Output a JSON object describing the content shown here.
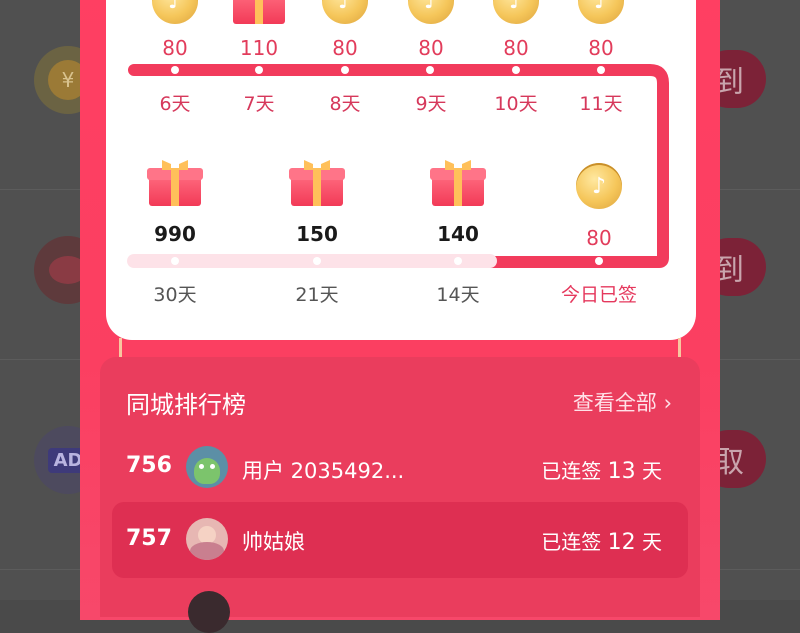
{
  "background": {
    "right_buttons": [
      "到",
      "到",
      "取"
    ],
    "left_icons": [
      "yen-coin-icon",
      "piggy-bank-icon",
      "ad-icon"
    ],
    "ad_label": "AD"
  },
  "signin": {
    "top_row": [
      {
        "type": "coin",
        "amount": "80",
        "day": "6天"
      },
      {
        "type": "gift",
        "amount": "110",
        "day": "7天"
      },
      {
        "type": "coin",
        "amount": "80",
        "day": "8天"
      },
      {
        "type": "coin",
        "amount": "80",
        "day": "9天"
      },
      {
        "type": "coin",
        "amount": "80",
        "day": "10天"
      },
      {
        "type": "coin",
        "amount": "80",
        "day": "11天"
      }
    ],
    "bottom_row": [
      {
        "type": "gift",
        "amount": "990",
        "day": "30天"
      },
      {
        "type": "gift",
        "amount": "150",
        "day": "21天"
      },
      {
        "type": "gift",
        "amount": "140",
        "day": "14天"
      },
      {
        "type": "coin",
        "amount": "80",
        "day": "今日已签"
      }
    ]
  },
  "leaderboard": {
    "title": "同城排行榜",
    "see_all": "查看全部 ›",
    "rows": [
      {
        "rank": "756",
        "name": "用户 2035492...",
        "streak_prefix": "已连签",
        "streak_days": "13",
        "streak_unit": "天"
      },
      {
        "rank": "757",
        "name": "帅姑娘",
        "streak_prefix": "已连签",
        "streak_days": "12",
        "streak_unit": "天"
      }
    ]
  },
  "colors": {
    "accent": "#ff3f62",
    "progress_line": "#f23b5c",
    "coin": "#f5c65a"
  }
}
